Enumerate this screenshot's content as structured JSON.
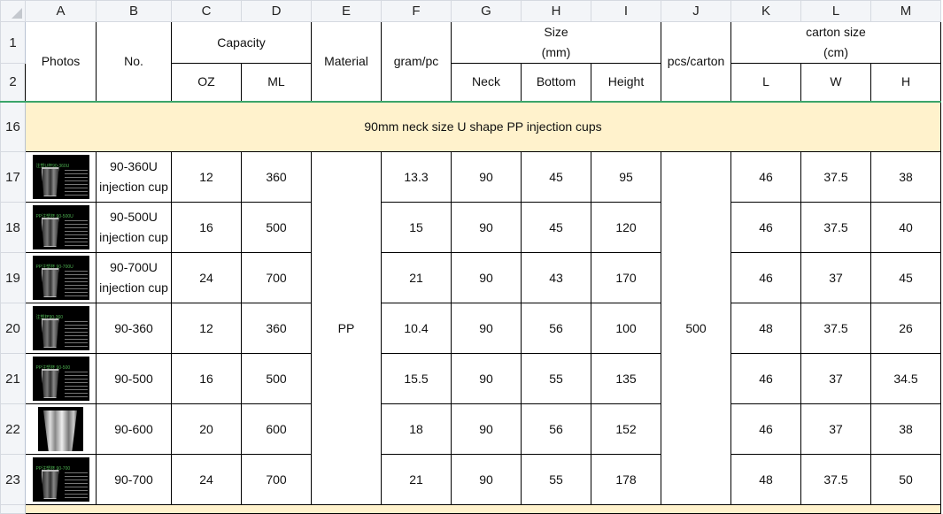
{
  "columns": [
    "A",
    "B",
    "C",
    "D",
    "E",
    "F",
    "G",
    "H",
    "I",
    "J",
    "K",
    "L",
    "M"
  ],
  "header": {
    "photos": "Photos",
    "no": "No.",
    "capacity": "Capacity",
    "oz": "OZ",
    "ml": "ML",
    "material": "Material",
    "gram": "gram/pc",
    "size": "Size\n(mm)",
    "neck": "Neck",
    "bottom": "Bottom",
    "height": "Height",
    "pcs": "pcs/carton",
    "carton": "carton size\n(cm)",
    "l": "L",
    "w": "W",
    "h": "H"
  },
  "header_rows": [
    "1",
    "2"
  ],
  "section": {
    "row": "16",
    "title": "90mm neck size U shape PP injection cups"
  },
  "material": "PP",
  "pcs_carton": "500",
  "rows": [
    {
      "row": "17",
      "photo_caption": "注塑U杯90-360U",
      "no": "90-360U\ninjection cup",
      "oz": "12",
      "ml": "360",
      "gram": "13.3",
      "neck": "90",
      "bottom": "45",
      "height": "95",
      "l": "46",
      "w": "37.5",
      "h": "38"
    },
    {
      "row": "18",
      "photo_caption": "PP注塑杯 90-500U",
      "no": "90-500U\ninjection cup",
      "oz": "16",
      "ml": "500",
      "gram": "15",
      "neck": "90",
      "bottom": "45",
      "height": "120",
      "l": "46",
      "w": "37.5",
      "h": "40"
    },
    {
      "row": "19",
      "photo_caption": "PP注塑杯 90-700U",
      "no": "90-700U\ninjection cup",
      "oz": "24",
      "ml": "700",
      "gram": "21",
      "neck": "90",
      "bottom": "43",
      "height": "170",
      "l": "46",
      "w": "37",
      "h": "45"
    },
    {
      "row": "20",
      "photo_caption": "注塑杯90-360",
      "no": "90-360",
      "oz": "12",
      "ml": "360",
      "gram": "10.4",
      "neck": "90",
      "bottom": "56",
      "height": "100",
      "l": "48",
      "w": "37.5",
      "h": "26"
    },
    {
      "row": "21",
      "photo_caption": "PP注塑杯 90-500",
      "no": "90-500",
      "oz": "16",
      "ml": "500",
      "gram": "15.5",
      "neck": "90",
      "bottom": "55",
      "height": "135",
      "l": "46",
      "w": "37",
      "h": "34.5"
    },
    {
      "row": "22",
      "photo_caption": "",
      "no": "90-600",
      "oz": "20",
      "ml": "600",
      "gram": "18",
      "neck": "90",
      "bottom": "56",
      "height": "152",
      "l": "46",
      "w": "37",
      "h": "38"
    },
    {
      "row": "23",
      "photo_caption": "PP注塑杯 90-700",
      "no": "90-700",
      "oz": "24",
      "ml": "700",
      "gram": "21",
      "neck": "90",
      "bottom": "55",
      "height": "178",
      "l": "48",
      "w": "37.5",
      "h": "50"
    }
  ]
}
